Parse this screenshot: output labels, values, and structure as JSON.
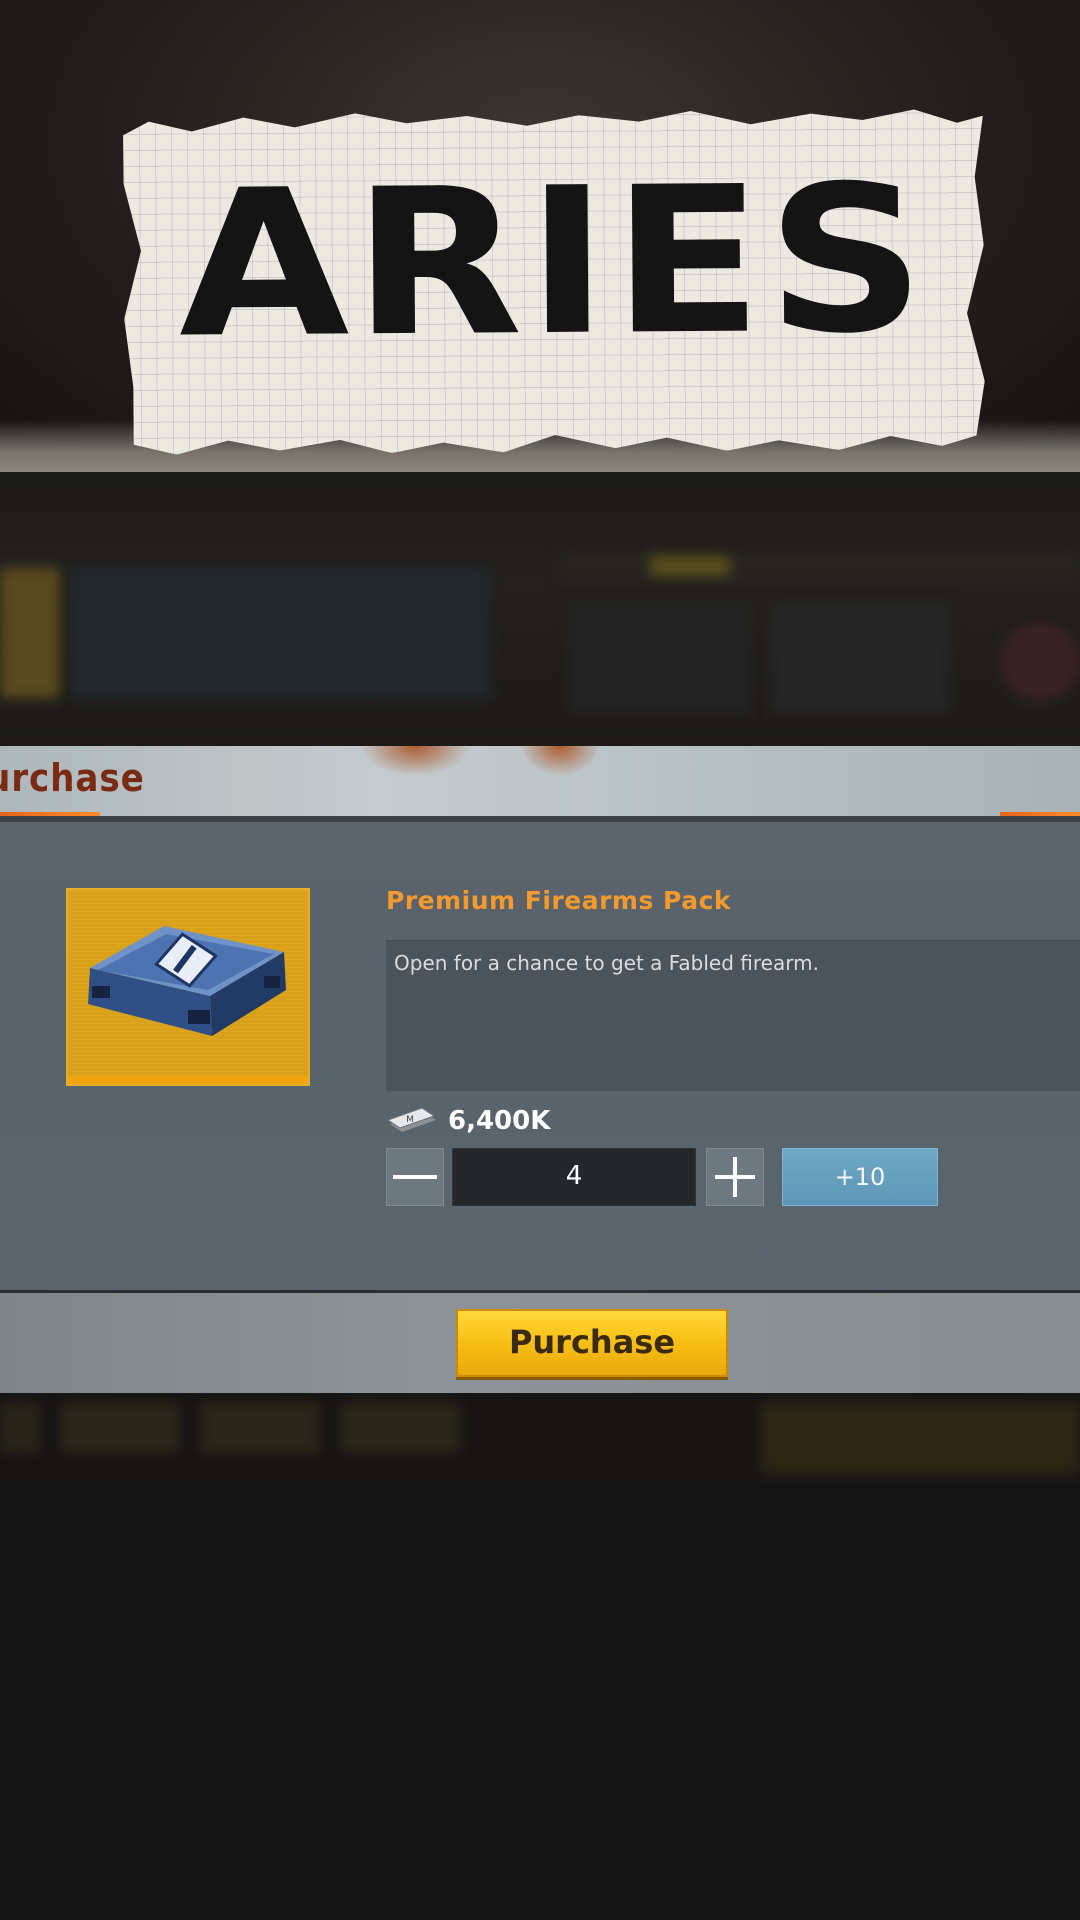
{
  "banner": {
    "title": "ARIES"
  },
  "dialog": {
    "title": "urchase",
    "item": {
      "name": "Premium Firearms Pack",
      "description": "Open for a chance to get a Fabled firearm.",
      "price": "6,400K",
      "currency_icon": "money-stack-icon",
      "item_icon": "weapon-crate-icon"
    },
    "quantity": {
      "value": "4",
      "minus_icon": "minus-icon",
      "plus_icon": "plus-icon",
      "plus10_label": "+10"
    },
    "purchase_label": "Purchase"
  },
  "colors": {
    "accent_orange": "#f49a2c",
    "purchase_yellow": "#f7be14",
    "item_frame_gold": "#d9a117",
    "plus10_blue": "#5d97b7",
    "title_rust": "#7a2b14"
  }
}
